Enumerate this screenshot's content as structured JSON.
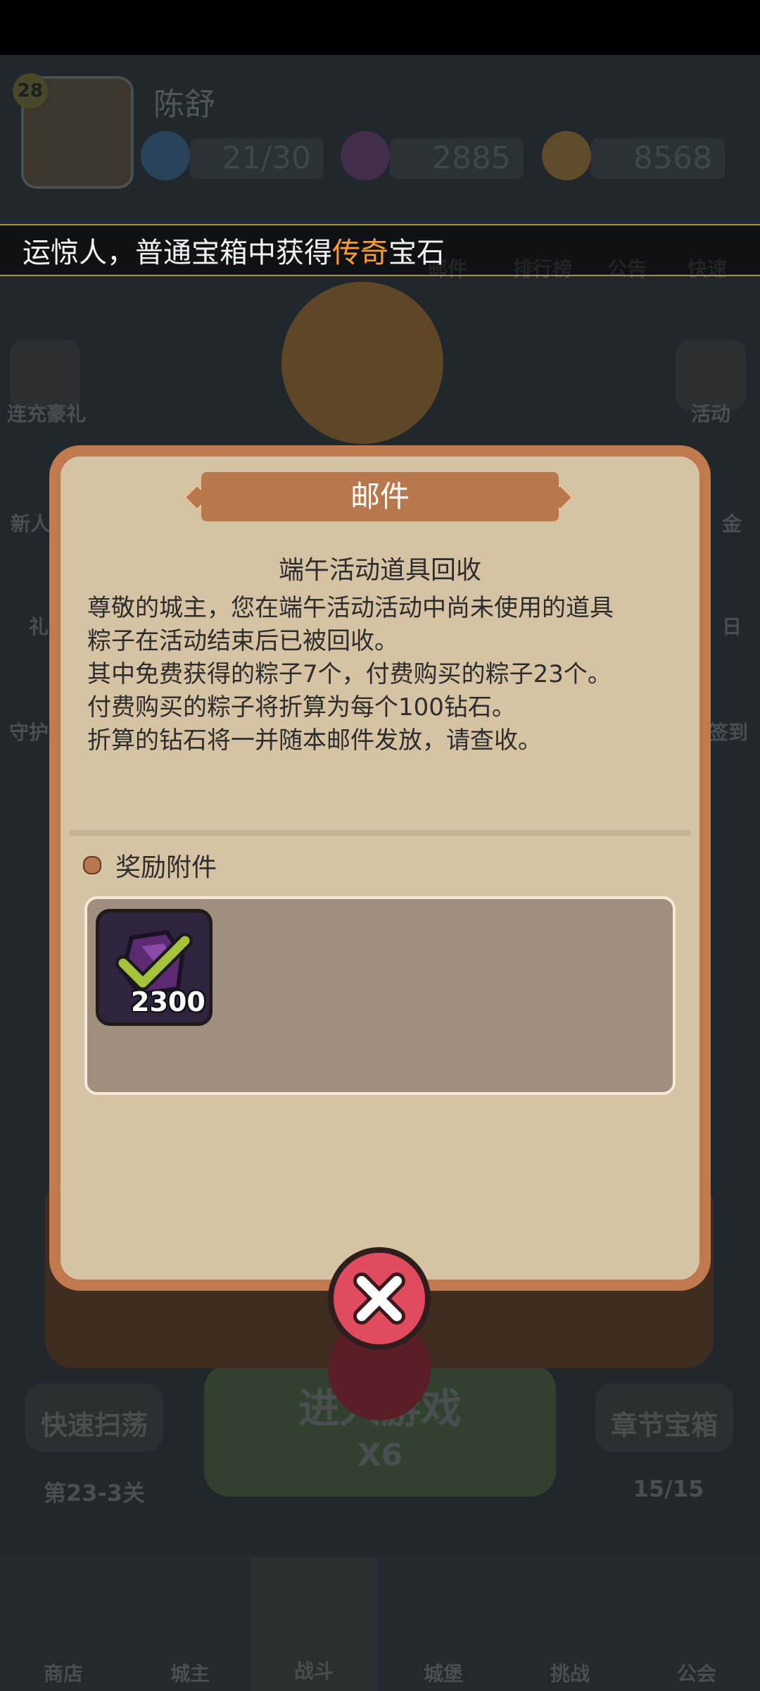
{
  "player": {
    "level": "28",
    "name": "陈舒"
  },
  "resources": {
    "energy": "21/30",
    "gems": "2885",
    "coins": "8568"
  },
  "announcement": {
    "prefix": "运惊人，普通宝箱中获得",
    "highlight": "传奇",
    "suffix": "宝石"
  },
  "top_buttons": [
    "邮件",
    "排行榜",
    "公告",
    "快速"
  ],
  "left_side": [
    "连充豪礼",
    "新人",
    "礼",
    "守护"
  ],
  "right_side": [
    "活动",
    "金",
    "日",
    "签到"
  ],
  "mail": {
    "title": "邮件",
    "subject": "端午活动道具回收",
    "body_lines": [
      "尊敬的城主，您在端午活动活动中尚未使用的道具",
      "粽子在活动结束后已被回收。",
      "其中免费获得的粽子7个，付费购买的粽子23个。",
      "付费购买的粽子将折算为每个100钻石。",
      "折算的钻石将一并随本邮件发放，请查收。"
    ],
    "reward_label": "奖励附件",
    "reward_count": "2300"
  },
  "bottom": {
    "sweep_label": "快速扫荡",
    "stage_label": "第23-3关",
    "play_label": "进入游戏",
    "cost_label": "X6",
    "chest_label": "章节宝箱",
    "stars_label": "15/15"
  },
  "nav": [
    "商店",
    "城主",
    "战斗",
    "城堡",
    "挑战",
    "公会"
  ],
  "colors": {
    "accent": "#b8774c",
    "panel": "#d7c4a6",
    "close": "#e04b5f",
    "highlight": "#ff9c2a"
  }
}
